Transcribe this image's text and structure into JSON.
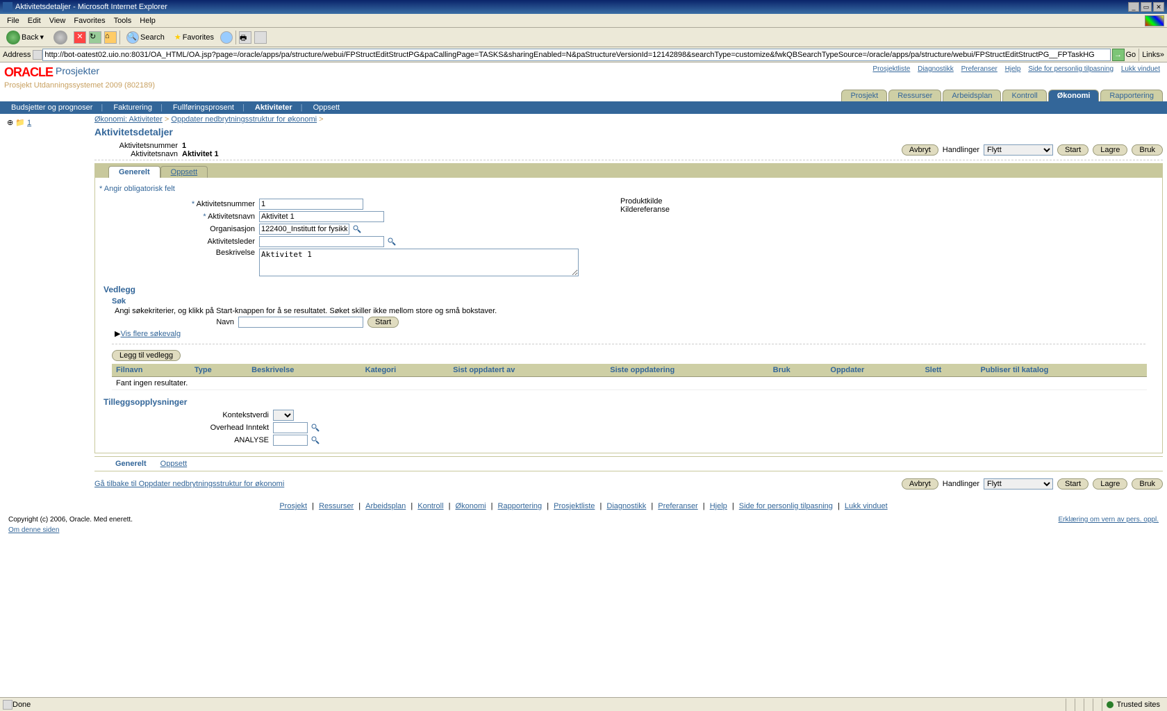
{
  "window": {
    "title": "Aktivitetsdetaljer - Microsoft Internet Explorer"
  },
  "menubar": {
    "file": "File",
    "edit": "Edit",
    "view": "View",
    "favorites": "Favorites",
    "tools": "Tools",
    "help": "Help"
  },
  "toolbar": {
    "back": "Back",
    "search": "Search",
    "favorites": "Favorites"
  },
  "address": {
    "label": "Address",
    "url": "http://bot-oatest02.uio.no:8031/OA_HTML/OA.jsp?page=/oracle/apps/pa/structure/webui/FPStructEditStructPG&paCallingPage=TASKS&sharingEnabled=N&paStructureVersionId=12142898&searchType=customize&fwkQBSearchTypeSource=/oracle/apps/pa/structure/webui/FPStructEditStructPG__FPTaskHG",
    "go": "Go",
    "links": "Links"
  },
  "oracle": {
    "logo": "ORACLE",
    "app": "Prosjekter",
    "subtitle": "Prosjekt Utdanningssystemet 2009 (802189)",
    "links": {
      "prosjektliste": "Prosjektliste",
      "diagnostikk": "Diagnostikk",
      "preferanser": "Preferanser",
      "hjelp": "Hjelp",
      "personlig": "Side for personlig tilpasning",
      "lukk": "Lukk vinduet"
    }
  },
  "tabs1": {
    "prosjekt": "Prosjekt",
    "ressurser": "Ressurser",
    "arbeidsplan": "Arbeidsplan",
    "kontroll": "Kontroll",
    "okonomi": "Økonomi",
    "rapportering": "Rapportering"
  },
  "subtabs": {
    "budsjetter": "Budsjetter og prognoser",
    "fakturering": "Fakturering",
    "fullforing": "Fullføringsprosent",
    "aktiviteter": "Aktiviteter",
    "oppsett": "Oppsett"
  },
  "tree": {
    "root": "1"
  },
  "crumb": {
    "a": "Økonomi: Aktiviteter",
    "b": "Oppdater nedbrytningsstruktur for økonomi"
  },
  "page": {
    "title": "Aktivitetsdetaljer",
    "num_label": "Aktivitetsnummer",
    "num": "1",
    "name_label": "Aktivitetsnavn",
    "name": "Aktivitet 1"
  },
  "actions": {
    "avbryt": "Avbryt",
    "handlinger": "Handlinger",
    "flytt": "Flytt",
    "start": "Start",
    "lagre": "Lagre",
    "bruk": "Bruk"
  },
  "ltabs": {
    "generelt": "Generelt",
    "oppsett": "Oppsett"
  },
  "form": {
    "req": "Angir obligatorisk felt",
    "aktivitetsnummer": "Aktivitetsnummer",
    "aktivitetsnummer_v": "1",
    "aktivitetsnavn": "Aktivitetsnavn",
    "aktivitetsnavn_v": "Aktivitet 1",
    "organisasjon": "Organisasjon",
    "organisasjon_v": "122400_Institutt for fysikk",
    "aktivitetsleder": "Aktivitetsleder",
    "aktivitetsleder_v": "",
    "beskrivelse": "Beskrivelse",
    "beskrivelse_v": "Aktivitet 1",
    "produktkilde": "Produktkilde",
    "kildereferanse": "Kildereferanse"
  },
  "vedlegg": {
    "title": "Vedlegg",
    "sok": "Søk",
    "help": "Angi søkekriterier, og klikk på Start-knappen for å se resultatet. Søket skiller ikke mellom store og små bokstaver.",
    "navn": "Navn",
    "start": "Start",
    "flere": "Vis flere søkevalg",
    "leggtil": "Legg til vedlegg",
    "cols": {
      "filnavn": "Filnavn",
      "type": "Type",
      "beskrivelse": "Beskrivelse",
      "kategori": "Kategori",
      "sistav": "Sist oppdatert av",
      "sistdato": "Siste oppdatering",
      "bruk": "Bruk",
      "oppdater": "Oppdater",
      "slett": "Slett",
      "publiser": "Publiser til katalog"
    },
    "empty": "Fant ingen resultater."
  },
  "tillegg": {
    "title": "Tilleggsopplysninger",
    "kontekst": "Kontekstverdi",
    "overhead": "Overhead Inntekt",
    "analyse": "ANALYSE"
  },
  "backlink": "Gå tilbake til Oppdater nedbrytningsstruktur for økonomi",
  "footer": {
    "links": {
      "prosjekt": "Prosjekt",
      "ressurser": "Ressurser",
      "arbeidsplan": "Arbeidsplan",
      "kontroll": "Kontroll",
      "okonomi": "Økonomi",
      "rapportering": "Rapportering",
      "prosjektliste": "Prosjektliste",
      "diagnostikk": "Diagnostikk",
      "preferanser": "Preferanser",
      "hjelp": "Hjelp",
      "personlig": "Side for personlig tilpasning",
      "lukk": "Lukk vinduet"
    },
    "copy": "Copyright (c) 2006, Oracle. Med enerett.",
    "about": "Om denne siden",
    "privacy": "Erklæring om vern av pers. oppl."
  },
  "status": {
    "done": "Done",
    "trusted": "Trusted sites"
  }
}
